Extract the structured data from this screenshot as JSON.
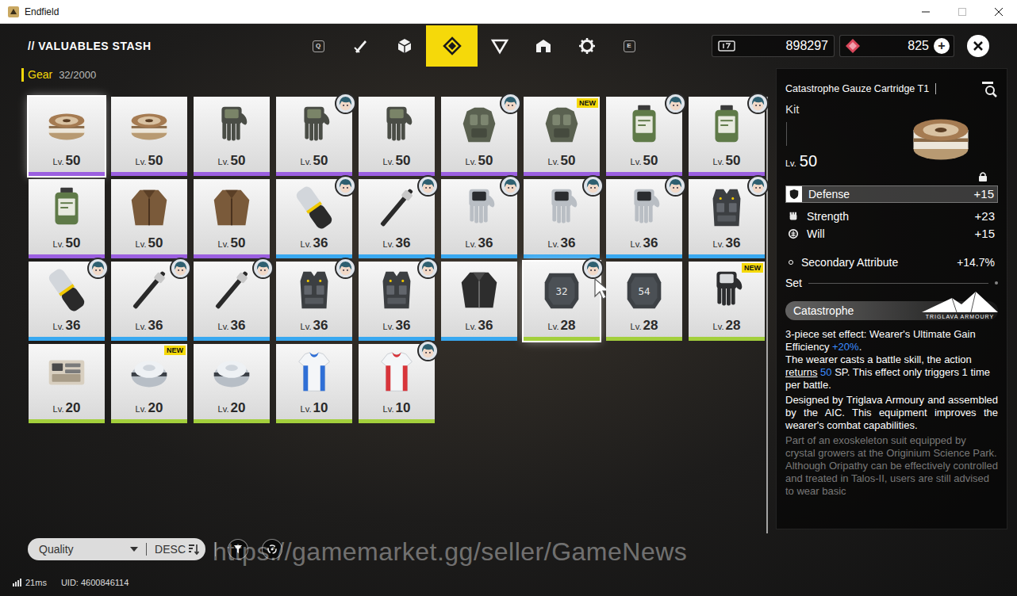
{
  "window": {
    "title": "Endfield"
  },
  "header": {
    "title": "// VALUABLES STASH",
    "key_left": "Q",
    "key_right": "E",
    "tabs": [
      {
        "kind": "weapon",
        "selected": false
      },
      {
        "kind": "cube",
        "selected": false
      },
      {
        "kind": "gear",
        "selected": true
      },
      {
        "kind": "triangle",
        "selected": false
      },
      {
        "kind": "crate",
        "selected": false
      },
      {
        "kind": "cog",
        "selected": false
      }
    ],
    "currencies": [
      {
        "kind": "ticket",
        "amount": "898297"
      },
      {
        "kind": "crystal",
        "amount": "825",
        "add": "+"
      }
    ]
  },
  "section": {
    "label": "Gear",
    "count": "32/2000"
  },
  "inventory": {
    "level_prefix": "Lv.",
    "items": [
      {
        "kind": "cartridge",
        "level": "50",
        "color": "#9b5fe0",
        "equipped": false,
        "selected": true,
        "hovered": false
      },
      {
        "kind": "cartridge",
        "level": "50",
        "color": "#9b5fe0",
        "equipped": false,
        "selected": false,
        "hovered": false
      },
      {
        "kind": "tacgloves",
        "level": "50",
        "color": "#9b5fe0",
        "equipped": false,
        "selected": false,
        "hovered": false
      },
      {
        "kind": "tacgloves",
        "level": "50",
        "color": "#9b5fe0",
        "equipped": true,
        "selected": false,
        "hovered": false
      },
      {
        "kind": "tacgloves",
        "level": "50",
        "color": "#9b5fe0",
        "equipped": false,
        "selected": false,
        "hovered": false
      },
      {
        "kind": "armor",
        "level": "50",
        "color": "#9b5fe0",
        "equipped": true,
        "selected": false,
        "hovered": false
      },
      {
        "kind": "armor",
        "level": "50",
        "color": "#9b5fe0",
        "equipped": false,
        "selected": false,
        "hovered": false,
        "badge": "NEW"
      },
      {
        "kind": "canister",
        "level": "50",
        "color": "#9b5fe0",
        "equipped": true,
        "selected": false,
        "hovered": false
      },
      {
        "kind": "canister",
        "level": "50",
        "color": "#9b5fe0",
        "equipped": true,
        "selected": false,
        "hovered": false
      },
      {
        "kind": "canister",
        "level": "50",
        "color": "#9b5fe0",
        "equipped": false,
        "selected": false,
        "hovered": false
      },
      {
        "kind": "jacket",
        "level": "50",
        "color": "#9b5fe0",
        "equipped": false,
        "selected": false,
        "hovered": false
      },
      {
        "kind": "jacket",
        "level": "50",
        "color": "#9b5fe0",
        "equipped": false,
        "selected": false,
        "hovered": false
      },
      {
        "kind": "cylinder",
        "level": "36",
        "color": "#38a8f0",
        "equipped": true,
        "selected": false,
        "hovered": false
      },
      {
        "kind": "baton",
        "level": "36",
        "color": "#38a8f0",
        "equipped": true,
        "selected": false,
        "hovered": false
      },
      {
        "kind": "silvergloves",
        "level": "36",
        "color": "#38a8f0",
        "equipped": true,
        "selected": false,
        "hovered": false
      },
      {
        "kind": "silvergloves",
        "level": "36",
        "color": "#38a8f0",
        "equipped": true,
        "selected": false,
        "hovered": false
      },
      {
        "kind": "silvergloves",
        "level": "36",
        "color": "#38a8f0",
        "equipped": true,
        "selected": false,
        "hovered": false
      },
      {
        "kind": "vest",
        "level": "36",
        "color": "#38a8f0",
        "equipped": true,
        "selected": false,
        "hovered": false
      },
      {
        "kind": "cylinder",
        "level": "36",
        "color": "#38a8f0",
        "equipped": true,
        "selected": false,
        "hovered": false
      },
      {
        "kind": "baton",
        "level": "36",
        "color": "#38a8f0",
        "equipped": true,
        "selected": false,
        "hovered": false
      },
      {
        "kind": "baton",
        "level": "36",
        "color": "#38a8f0",
        "equipped": true,
        "selected": false,
        "hovered": false
      },
      {
        "kind": "vest",
        "level": "36",
        "color": "#38a8f0",
        "equipped": true,
        "selected": false,
        "hovered": false
      },
      {
        "kind": "vest",
        "level": "36",
        "color": "#38a8f0",
        "equipped": true,
        "selected": false,
        "hovered": false
      },
      {
        "kind": "leather",
        "level": "36",
        "color": "#38a8f0",
        "equipped": false,
        "selected": false,
        "hovered": false
      },
      {
        "kind": "plate",
        "level": "28",
        "color": "#a3cf3c",
        "equipped": true,
        "selected": false,
        "hovered": true,
        "label": "32"
      },
      {
        "kind": "plate",
        "level": "28",
        "color": "#a3cf3c",
        "equipped": false,
        "selected": false,
        "hovered": false,
        "label": "54"
      },
      {
        "kind": "darkgloves",
        "level": "28",
        "color": "#a3cf3c",
        "equipped": false,
        "selected": false,
        "hovered": false,
        "badge": "NEW"
      },
      {
        "kind": "device",
        "level": "20",
        "color": "#a3cf3c",
        "equipped": false,
        "selected": false,
        "hovered": false
      },
      {
        "kind": "sphere",
        "level": "20",
        "color": "#a3cf3c",
        "equipped": false,
        "selected": false,
        "hovered": false,
        "badge": "NEW"
      },
      {
        "kind": "sphere",
        "level": "20",
        "color": "#a3cf3c",
        "equipped": false,
        "selected": false,
        "hovered": false
      },
      {
        "kind": "sportshirt",
        "level": "10",
        "color": "#a3cf3c",
        "equipped": false,
        "selected": false,
        "hovered": false
      },
      {
        "kind": "racingshirt",
        "level": "10",
        "color": "#a3cf3c",
        "equipped": true,
        "selected": false,
        "hovered": false
      }
    ]
  },
  "detail": {
    "name": "Catastrophe Gauze Cartridge T1",
    "type": "Kit",
    "level_prefix": "Lv.",
    "level": "50",
    "kind": "cartridge",
    "locked": true,
    "stats": [
      {
        "kind": "defense",
        "label": "Defense",
        "value": "+15",
        "highlighted": true
      },
      {
        "kind": "strength",
        "label": "Strength",
        "value": "+23",
        "highlighted": false
      },
      {
        "kind": "will",
        "label": "Will",
        "value": "+15",
        "highlighted": false
      }
    ],
    "secondary": {
      "label": "Secondary Attribute",
      "value": "+14.7%"
    },
    "set_label": "Set",
    "set_name": "Catastrophe",
    "brand": "TRIGLAVA ARMOURY",
    "effect": [
      {
        "text": "3-piece set effect: Wearer's Ultimate Gain Efficiency ",
        "kind": "plain"
      },
      {
        "text": "+20%",
        "kind": "value"
      },
      {
        "text": ".\nThe wearer casts a battle skill, the action ",
        "kind": "plain"
      },
      {
        "text": "returns",
        "kind": "term"
      },
      {
        "text": " ",
        "kind": "plain"
      },
      {
        "text": "50",
        "kind": "value"
      },
      {
        "text": " SP. This effect only triggers 1 time per battle.",
        "kind": "plain"
      }
    ],
    "about": "Designed by Triglava Armoury and assembled by the AIC. This equipment improves the wearer's combat capabilities.",
    "lore": "Part of an exoskeleton suit equipped by crystal growers at the Originium Science Park.\nAlthough Oripathy can be effectively controlled and treated in Talos-II, users are still advised to wear basic"
  },
  "toolbar": {
    "sort": "Quality",
    "order": "DESC"
  },
  "status": {
    "ping": "21ms",
    "uid": "UID: 4600846114"
  },
  "watermark": "https://gamemarket.gg/seller/GameNews"
}
